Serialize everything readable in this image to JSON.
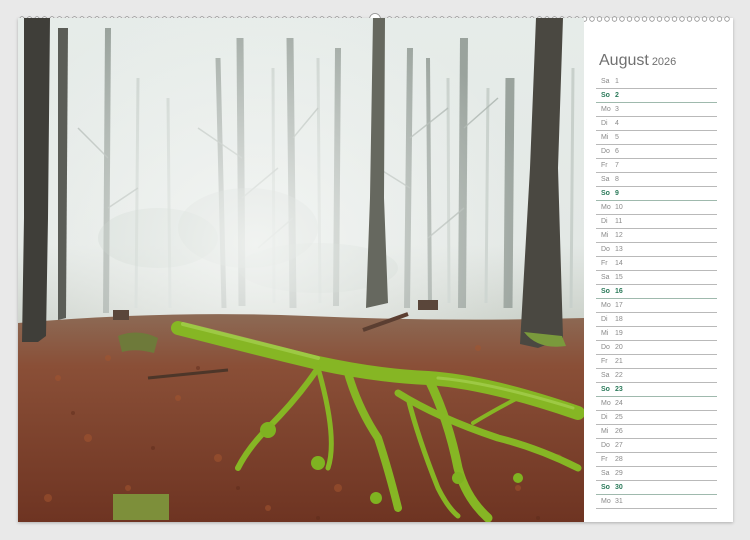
{
  "calendar": {
    "month": "August",
    "year": "2026",
    "days": [
      {
        "wd": "Sa",
        "d": "1",
        "sun": false
      },
      {
        "wd": "So",
        "d": "2",
        "sun": true
      },
      {
        "wd": "Mo",
        "d": "3",
        "sun": false
      },
      {
        "wd": "Di",
        "d": "4",
        "sun": false
      },
      {
        "wd": "Mi",
        "d": "5",
        "sun": false
      },
      {
        "wd": "Do",
        "d": "6",
        "sun": false
      },
      {
        "wd": "Fr",
        "d": "7",
        "sun": false
      },
      {
        "wd": "Sa",
        "d": "8",
        "sun": false
      },
      {
        "wd": "So",
        "d": "9",
        "sun": true
      },
      {
        "wd": "Mo",
        "d": "10",
        "sun": false
      },
      {
        "wd": "Di",
        "d": "11",
        "sun": false
      },
      {
        "wd": "Mi",
        "d": "12",
        "sun": false
      },
      {
        "wd": "Do",
        "d": "13",
        "sun": false
      },
      {
        "wd": "Fr",
        "d": "14",
        "sun": false
      },
      {
        "wd": "Sa",
        "d": "15",
        "sun": false
      },
      {
        "wd": "So",
        "d": "16",
        "sun": true
      },
      {
        "wd": "Mo",
        "d": "17",
        "sun": false
      },
      {
        "wd": "Di",
        "d": "18",
        "sun": false
      },
      {
        "wd": "Mi",
        "d": "19",
        "sun": false
      },
      {
        "wd": "Do",
        "d": "20",
        "sun": false
      },
      {
        "wd": "Fr",
        "d": "21",
        "sun": false
      },
      {
        "wd": "Sa",
        "d": "22",
        "sun": false
      },
      {
        "wd": "So",
        "d": "23",
        "sun": true
      },
      {
        "wd": "Mo",
        "d": "24",
        "sun": false
      },
      {
        "wd": "Di",
        "d": "25",
        "sun": false
      },
      {
        "wd": "Mi",
        "d": "26",
        "sun": false
      },
      {
        "wd": "Do",
        "d": "27",
        "sun": false
      },
      {
        "wd": "Fr",
        "d": "28",
        "sun": false
      },
      {
        "wd": "Sa",
        "d": "29",
        "sun": false
      },
      {
        "wd": "So",
        "d": "30",
        "sun": true
      },
      {
        "wd": "Mo",
        "d": "31",
        "sun": false
      }
    ]
  },
  "colors": {
    "sunday": "#2b7a5a",
    "weekday": "#8a8a8a",
    "fog": "#dfe6e2",
    "leaf_floor": "#8a4a30",
    "moss": "#7fb321"
  },
  "photo": {
    "subject": "foggy-beech-forest-with-mossy-fallen-tree-icon"
  }
}
